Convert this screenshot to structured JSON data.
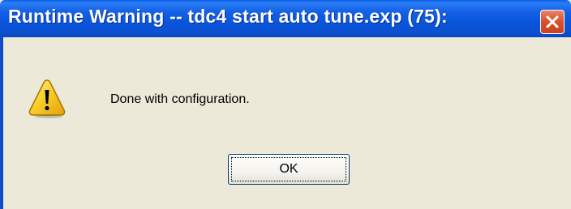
{
  "window": {
    "title": "Runtime Warning -- tdc4 start auto tune.exp (75):",
    "close_icon": "close-icon"
  },
  "dialog": {
    "icon": "warning-icon",
    "message": "Done with configuration.",
    "ok_label": "OK"
  },
  "colors": {
    "titlebar": "#0a55dc",
    "body": "#ece9d8",
    "close_button": "#d9552f",
    "warning_icon": "#f7c31b"
  }
}
